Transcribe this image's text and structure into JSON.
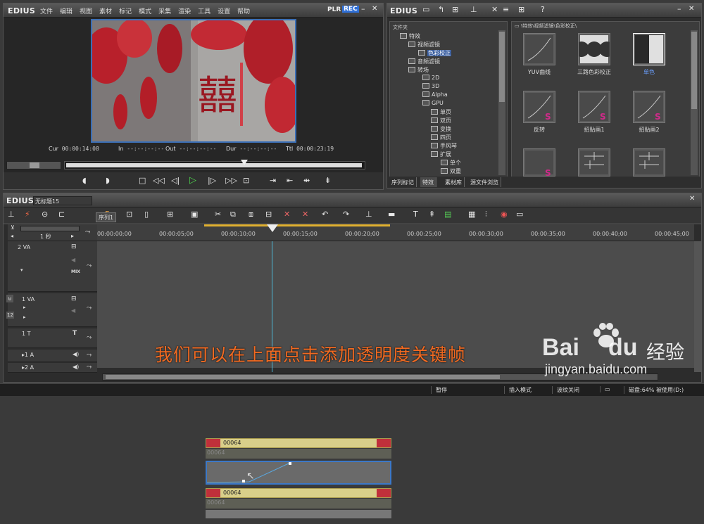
{
  "player": {
    "logo": "EDIUS",
    "menu": [
      "文件",
      "编辑",
      "视图",
      "素材",
      "标记",
      "模式",
      "采集",
      "渲染",
      "工具",
      "设置",
      "帮助"
    ],
    "mode_plr": "PLR",
    "mode_rec": "REC",
    "cur_label": "Cur",
    "cur_value": "00:00:14:08",
    "in_label": "In",
    "in_value": "--:--:--:--",
    "out_label": "Out",
    "out_value": "--:--:--:--",
    "dur_label": "Dur",
    "dur_value": "--:--:--:--",
    "ttl_label": "Ttl",
    "ttl_value": "00:00:23:19",
    "preview_glyph": "囍"
  },
  "bin": {
    "logo": "EDIUS",
    "folder_header": "文件夹",
    "path": "\\特效\\视频滤镜\\色彩校正\\",
    "tree": [
      "特效",
      "视频滤镜",
      "色彩校正",
      "音频滤镜",
      "转场",
      "2D",
      "3D",
      "Alpha",
      "GPU",
      "单页",
      "双页",
      "变换",
      "四页",
      "手风琴",
      "扩展",
      "单个",
      "双重"
    ],
    "effects": [
      "YUV曲线",
      "三路色彩校正",
      "单色",
      "反转",
      "招贴画1",
      "招贴画2"
    ],
    "tabs": [
      "序列标记",
      "特效",
      "素材库",
      "源文件浏览"
    ]
  },
  "timeline": {
    "logo": "EDIUS",
    "project": "无标题15",
    "sequence_tab": "序列1",
    "scale": "1 秒",
    "ruler": [
      "00:00:00;00",
      "00:00:05;00",
      "00:00:10;00",
      "00:00:15;00",
      "00:00:20;00",
      "00:00:25;00",
      "00:00:30;00",
      "00:00:35;00",
      "00:00:40;00",
      "00:00:45;00"
    ],
    "tracks": {
      "va2": "2 VA",
      "va1": "1 VA",
      "t1": "1 T",
      "a1": "1 A",
      "a2": "2 A"
    },
    "mix_label": "MIX",
    "clip_name": "00064",
    "track_num_1": "1",
    "track_num_2": "2"
  },
  "status": {
    "pause": "暂停",
    "insert_mode": "插入模式",
    "ripple": "波纹关闭",
    "disk": "磁盘:64% 被使用(D:)"
  },
  "overlay": {
    "caption": "我们可以在上面点击添加透明度关键帧",
    "watermark_url": "jingyan.baidu.com",
    "watermark_cn": "经验",
    "watermark_logo_a": "Bai",
    "watermark_logo_b": "du"
  },
  "colors": {
    "caption": "#f26a21",
    "rec_badge": "#2f6fd6",
    "clip_title": "#d9cf8a",
    "playhead": "#4fb8d8"
  }
}
